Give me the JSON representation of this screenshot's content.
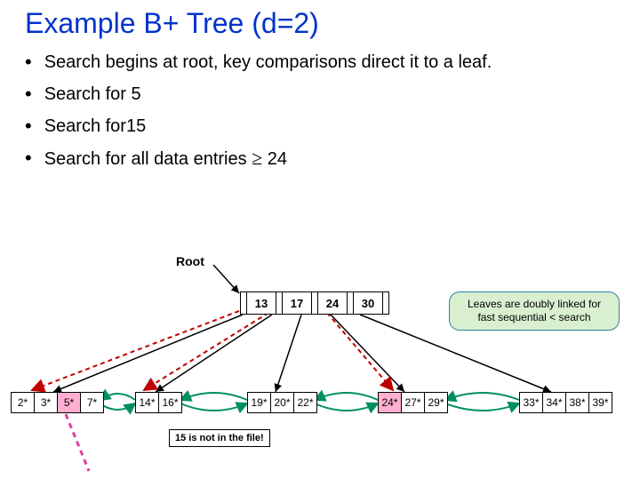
{
  "title": "Example B+ Tree (d=2)",
  "bullets": {
    "b1": "Search begins at root, key comparisons direct it to a leaf.",
    "b2": "Search for 5",
    "b3": "Search for15",
    "b4_pre": "Search for all data entries ",
    "b4_sym": "≥",
    "b4_post": " 24"
  },
  "root_label": "Root",
  "root_keys": {
    "k1": "13",
    "k2": "17",
    "k3": "24",
    "k4": "30"
  },
  "leaves": {
    "l1": {
      "c1": "2*",
      "c2": "3*",
      "c3": "5*",
      "c4": "7*"
    },
    "l2": {
      "c1": "14*",
      "c2": "16*"
    },
    "l3": {
      "c1": "19*",
      "c2": "20*",
      "c3": "22*"
    },
    "l4": {
      "c1": "24*",
      "c2": "27*",
      "c3": "29*"
    },
    "l5": {
      "c1": "33*",
      "c2": "34*",
      "c3": "38*",
      "c4": "39*"
    }
  },
  "callout": {
    "line1": "Leaves are doubly linked for",
    "line2": "fast sequential < search"
  },
  "note": "15 is not in the file!"
}
